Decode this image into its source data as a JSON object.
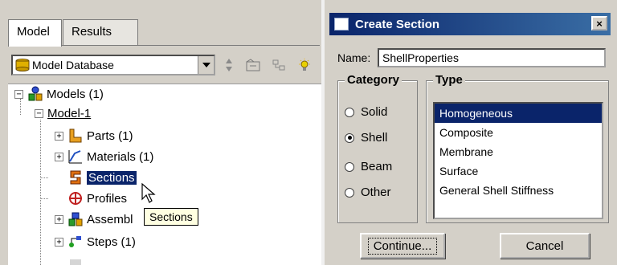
{
  "model_tree": {
    "tabs": [
      {
        "label": "Model",
        "active": true
      },
      {
        "label": "Results",
        "active": false
      }
    ],
    "database_selector": {
      "value": "Model Database",
      "icon": "database-icon"
    },
    "toolbar_icons": [
      "sort-up-down-icon",
      "folder-icon",
      "filter-icon",
      "bulb-icon"
    ],
    "nodes": {
      "models": "Models (1)",
      "model1": "Model-1",
      "parts": "Parts (1)",
      "materials": "Materials (1)",
      "sections": "Sections",
      "profiles": "Profiles",
      "assembly": "Assembl",
      "steps": "Steps (1)"
    },
    "tooltip": "Sections",
    "selection_color": "#0a246a"
  },
  "dialog": {
    "title": "Create Section",
    "close_label": "×",
    "name_label": "Name:",
    "name_value": "ShellProperties",
    "category": {
      "legend": "Category",
      "options": [
        "Solid",
        "Shell",
        "Beam",
        "Other"
      ],
      "selected": "Shell"
    },
    "type": {
      "legend": "Type",
      "options": [
        "Homogeneous",
        "Composite",
        "Membrane",
        "Surface",
        "General Shell Stiffness"
      ],
      "selected": "Homogeneous"
    },
    "continue_label": "Continue...",
    "cancel_label": "Cancel",
    "title_color": "#0a246a"
  }
}
